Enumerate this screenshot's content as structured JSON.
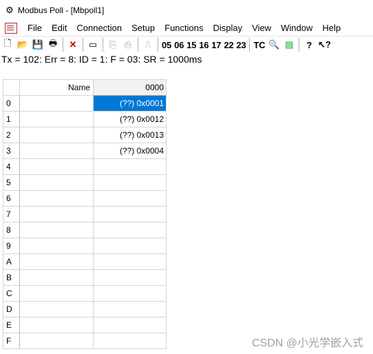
{
  "window": {
    "title": "Modbus Poll - [Mbpoll1]",
    "app_icon": "modbus-app-icon"
  },
  "menu": [
    "File",
    "Edit",
    "Connection",
    "Setup",
    "Functions",
    "Display",
    "View",
    "Window",
    "Help"
  ],
  "toolbar": {
    "function_codes": [
      "05",
      "06",
      "15",
      "16",
      "17",
      "22",
      "23"
    ],
    "tc_label": "TC"
  },
  "status_line": "Tx = 102: Err = 8: ID = 1: F = 03: SR = 1000ms",
  "grid": {
    "name_header": "Name",
    "column_header": "0000",
    "rows": [
      {
        "id": "0",
        "name": "",
        "value": "(??) 0x0001",
        "selected": true
      },
      {
        "id": "1",
        "name": "",
        "value": "(??) 0x0012"
      },
      {
        "id": "2",
        "name": "",
        "value": "(??) 0x0013"
      },
      {
        "id": "3",
        "name": "",
        "value": "(??) 0x0004"
      },
      {
        "id": "4",
        "name": "",
        "value": ""
      },
      {
        "id": "5",
        "name": "",
        "value": ""
      },
      {
        "id": "6",
        "name": "",
        "value": ""
      },
      {
        "id": "7",
        "name": "",
        "value": ""
      },
      {
        "id": "8",
        "name": "",
        "value": ""
      },
      {
        "id": "9",
        "name": "",
        "value": ""
      },
      {
        "id": "A",
        "name": "",
        "value": ""
      },
      {
        "id": "B",
        "name": "",
        "value": ""
      },
      {
        "id": "C",
        "name": "",
        "value": ""
      },
      {
        "id": "D",
        "name": "",
        "value": ""
      },
      {
        "id": "E",
        "name": "",
        "value": ""
      },
      {
        "id": "F",
        "name": "",
        "value": ""
      }
    ]
  },
  "watermark": "CSDN @小光学嵌入式",
  "colors": {
    "selection": "#0078d7"
  }
}
